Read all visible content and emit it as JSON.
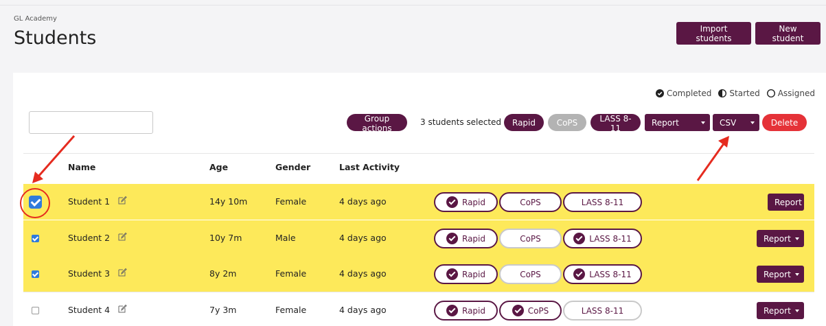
{
  "org_name": "GL Academy",
  "page_title": "Students",
  "header_buttons": {
    "import": "Import students",
    "new": "New student"
  },
  "legend": {
    "completed": "Completed",
    "started": "Started",
    "assigned": "Assigned"
  },
  "search": {
    "value": "",
    "placeholder": ""
  },
  "toolbar": {
    "group_actions": "Group actions",
    "selected_count": "3 students selected",
    "rapid": "Rapid",
    "cops": "CoPS",
    "lass": "LASS 8-11",
    "report": "Report",
    "csv": "CSV",
    "delete": "Delete"
  },
  "columns": {
    "name": "Name",
    "age": "Age",
    "gender": "Gender",
    "last_activity": "Last Activity"
  },
  "rows": [
    {
      "name": "Student 1",
      "age": "14y 10m",
      "gender": "Female",
      "last": "4 days ago",
      "rapid": "Rapid",
      "cops": "CoPS",
      "lass": "LASS 8-11",
      "report": "Report"
    },
    {
      "name": "Student 2",
      "age": "10y 7m",
      "gender": "Male",
      "last": "4 days ago",
      "rapid": "Rapid",
      "cops": "CoPS",
      "lass": "LASS 8-11",
      "report": "Report"
    },
    {
      "name": "Student 3",
      "age": "8y 2m",
      "gender": "Female",
      "last": "4 days ago",
      "rapid": "Rapid",
      "cops": "CoPS",
      "lass": "LASS 8-11",
      "report": "Report"
    },
    {
      "name": "Student 4",
      "age": "7y 3m",
      "gender": "Female",
      "last": "4 days ago",
      "rapid": "Rapid",
      "cops": "CoPS",
      "lass": "LASS 8-11",
      "report": "Report"
    }
  ],
  "colors": {
    "brand": "#5a1744",
    "selected_row": "#fde95a",
    "delete": "#e53238",
    "disabled": "#b3b3b3",
    "checkbox": "#2f7bdc",
    "annotation": "#e52b1f"
  }
}
